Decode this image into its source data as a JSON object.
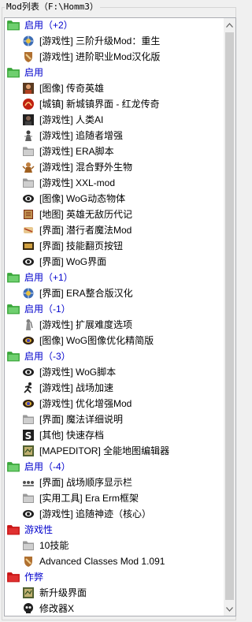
{
  "window": {
    "title": "Mod列表（F:\\Homm3）"
  },
  "colors": {
    "folder_green": "#3aa63a",
    "folder_red": "#c81414",
    "group_text": "#0000cc"
  },
  "tree": [
    {
      "type": "group",
      "label": "启用（+2）",
      "folder": "green"
    },
    {
      "type": "item",
      "label": "[游戏性] 三阶升级Mod：重生",
      "icon": "globe-icon"
    },
    {
      "type": "item",
      "label": "[游戏性] 进阶职业Mod汉化版",
      "icon": "shield-icon"
    },
    {
      "type": "group",
      "label": "启用",
      "folder": "green"
    },
    {
      "type": "item",
      "label": "[图像] 传奇英雄",
      "icon": "hero-portrait-icon"
    },
    {
      "type": "item",
      "label": "[城镇] 新城镇界面 - 红龙传奇",
      "icon": "red-dragon-icon"
    },
    {
      "type": "item",
      "label": "[游戏性] 人类AI",
      "icon": "dark-portrait-icon"
    },
    {
      "type": "item",
      "label": "[游戏性] 追随者增强",
      "icon": "follower-icon"
    },
    {
      "type": "item",
      "label": "[游戏性] ERA脚本",
      "icon": "gray-folder-icon"
    },
    {
      "type": "item",
      "label": "[游戏性] 混合野外生物",
      "icon": "creature-icon"
    },
    {
      "type": "item",
      "label": "[游戏性] XXL-mod",
      "icon": "gray-folder-icon"
    },
    {
      "type": "item",
      "label": "[图像] WoG动态物体",
      "icon": "wog-eye-icon"
    },
    {
      "type": "item",
      "label": "[地图] 英雄无敌历代记",
      "icon": "book-icon"
    },
    {
      "type": "item",
      "label": "[界面] 潜行者魔法Mod",
      "icon": "scroll-icon"
    },
    {
      "type": "item",
      "label": "[界面] 技能翻页按钮",
      "icon": "button-icon"
    },
    {
      "type": "item",
      "label": "[界面] WoG界面",
      "icon": "wog-eye-icon"
    },
    {
      "type": "group",
      "label": "启用（+1）",
      "folder": "green"
    },
    {
      "type": "item",
      "label": "[界面] ERA整合版汉化",
      "icon": "globe-icon"
    },
    {
      "type": "group",
      "label": "启用（-1）",
      "folder": "green"
    },
    {
      "type": "item",
      "label": "[游戏性] 扩展难度选项",
      "icon": "knight-icon"
    },
    {
      "type": "item",
      "label": "[图像] WoG图像优化精简版",
      "icon": "wog-color-icon"
    },
    {
      "type": "group",
      "label": "启用（-3）",
      "folder": "green"
    },
    {
      "type": "item",
      "label": "[游戏性] WoG脚本",
      "icon": "wog-eye-icon"
    },
    {
      "type": "item",
      "label": "[游戏性] 战场加速",
      "icon": "runner-icon"
    },
    {
      "type": "item",
      "label": "[游戏性] 优化增强Mod",
      "icon": "wog-color-icon"
    },
    {
      "type": "item",
      "label": "[界面] 魔法详细说明",
      "icon": "gray-folder-icon"
    },
    {
      "type": "item",
      "label": "[其他] 快速存档",
      "icon": "save-icon"
    },
    {
      "type": "item",
      "label": "[MAPEDITOR] 全能地图编辑器",
      "icon": "map-icon"
    },
    {
      "type": "group",
      "label": "启用（-4）",
      "folder": "green"
    },
    {
      "type": "item",
      "label": "[界面] 战场顺序显示栏",
      "icon": "order-icon"
    },
    {
      "type": "item",
      "label": "[实用工具] Era Erm框架",
      "icon": "gray-folder-icon"
    },
    {
      "type": "item",
      "label": "[游戏性] 追随神迹（核心）",
      "icon": "wog-eye-icon"
    },
    {
      "type": "group",
      "label": "游戏性",
      "folder": "red"
    },
    {
      "type": "item",
      "label": "10技能",
      "icon": "gray-folder-icon"
    },
    {
      "type": "item",
      "label": "Advanced Classes Mod 1.091",
      "icon": "shield-icon"
    },
    {
      "type": "group",
      "label": "作弊",
      "folder": "red"
    },
    {
      "type": "item",
      "label": "新升级界面",
      "icon": "map-icon"
    },
    {
      "type": "item",
      "label": "修改器X",
      "icon": "skull-icon"
    }
  ]
}
